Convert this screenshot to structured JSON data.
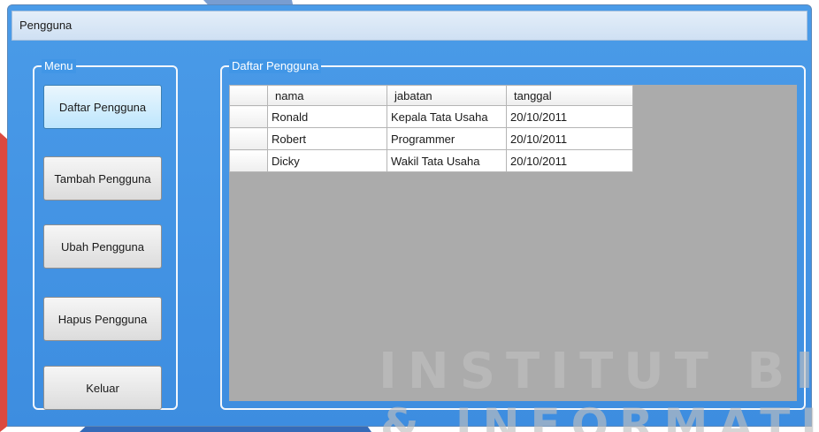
{
  "window": {
    "title": "Pengguna"
  },
  "menu": {
    "legend": "Menu",
    "buttons": [
      {
        "label": "Daftar Pengguna"
      },
      {
        "label": "Tambah Pengguna"
      },
      {
        "label": "Ubah Pengguna"
      },
      {
        "label": "Hapus Pengguna"
      },
      {
        "label": "Keluar"
      }
    ]
  },
  "list": {
    "legend": "Daftar Pengguna",
    "columns": [
      "nama",
      "jabatan",
      "tanggal"
    ],
    "rows": [
      {
        "nama": "Ronald",
        "jabatan": "Kepala Tata Usaha",
        "tanggal": "20/10/2011"
      },
      {
        "nama": "Robert",
        "jabatan": "Programmer",
        "tanggal": "20/10/2011"
      },
      {
        "nama": "Dicky",
        "jabatan": "Wakil Tata Usaha",
        "tanggal": "20/10/2011"
      }
    ]
  },
  "watermark": {
    "line1": "INSTITUT BISN",
    "line2": "& INFORMATIK"
  },
  "colors": {
    "window_frame": "#3d8de0",
    "group_border": "#f3f7fc",
    "grid_background": "#ababab",
    "watermark_red": "#d8352a",
    "watermark_blue": "#1f5bb0"
  }
}
